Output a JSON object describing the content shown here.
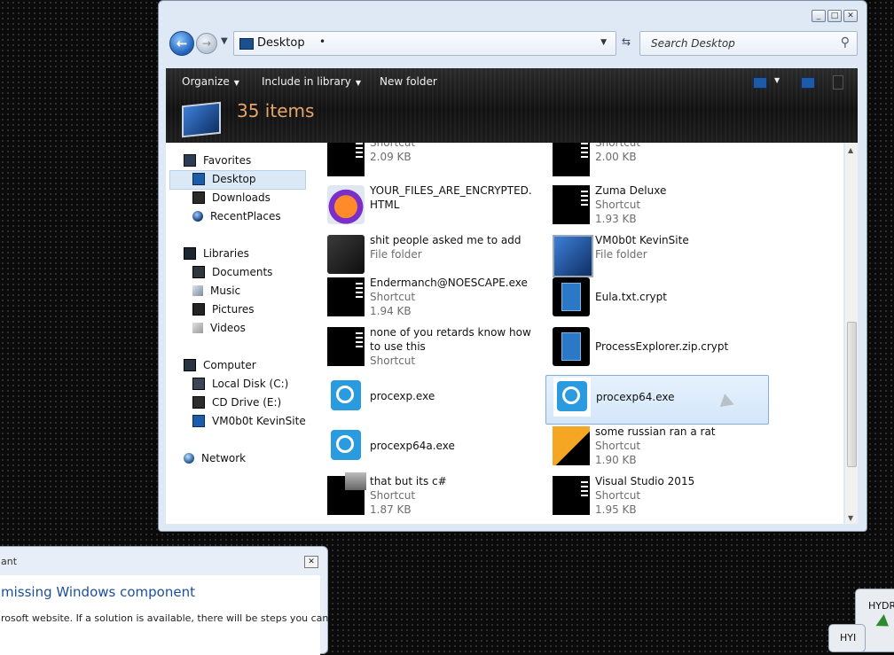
{
  "window": {
    "address": "Desktop",
    "search_placeholder": "Search Desktop",
    "caption_buttons": [
      "_",
      "□",
      "✕"
    ],
    "nav_back_glyph": "←",
    "nav_fwd_glyph": "→"
  },
  "toolbar": {
    "organize": "Organize",
    "include_in_library": "Include in library",
    "new_folder": "New folder",
    "items_count": "35 items"
  },
  "nav_pane": {
    "favorites": "Favorites",
    "desktop": "Desktop",
    "downloads": "Downloads",
    "recent_places": "RecentPlaces",
    "libraries": "Libraries",
    "documents": "Documents",
    "music": "Music",
    "pictures": "Pictures",
    "videos": "Videos",
    "computer": "Computer",
    "local_disk": "Local Disk (C:)",
    "cd_drive": "CD Drive (E:)",
    "kevinsite": "VM0b0t KevinSite",
    "network": "Network"
  },
  "files": [
    {
      "name": "",
      "type": "Shortcut",
      "size": "2.09 KB"
    },
    {
      "name": "",
      "type": "Shortcut",
      "size": "2.00 KB"
    },
    {
      "name": "YOUR_FILES_ARE_ENCRYPTED.HTML",
      "type": "",
      "size": ""
    },
    {
      "name": "Zuma Deluxe",
      "type": "Shortcut",
      "size": "1.93 KB"
    },
    {
      "name": "shit people asked me to add",
      "type": "File folder",
      "size": ""
    },
    {
      "name": "VM0b0t KevinSite",
      "type": "File folder",
      "size": ""
    },
    {
      "name": "Endermanch@NOESCAPE.exe",
      "type": "Shortcut",
      "size": "1.94 KB"
    },
    {
      "name": "Eula.txt.crypt",
      "type": "",
      "size": ""
    },
    {
      "name": "none of you retards know how to use this",
      "type": "Shortcut",
      "size": ""
    },
    {
      "name": "ProcessExplorer.zip.crypt",
      "type": "",
      "size": ""
    },
    {
      "name": "procexp.exe",
      "type": "",
      "size": ""
    },
    {
      "name": "procexp64.exe",
      "type": "",
      "size": ""
    },
    {
      "name": "procexp64a.exe",
      "type": "",
      "size": ""
    },
    {
      "name": "some russian ran a rat",
      "type": "Shortcut",
      "size": "1.90 KB"
    },
    {
      "name": "that but its c#",
      "type": "Shortcut",
      "size": "1.87 KB"
    },
    {
      "name": "Visual Studio 2015",
      "type": "Shortcut",
      "size": "1.95 KB"
    }
  ],
  "dialog": {
    "title": "ant",
    "heading": "missing Windows component",
    "text": "rosoft website. If a solution is available, there will be steps you can"
  },
  "taskbar_fragments": {
    "hydra1": "HYDR",
    "hydra2": "HYI"
  }
}
